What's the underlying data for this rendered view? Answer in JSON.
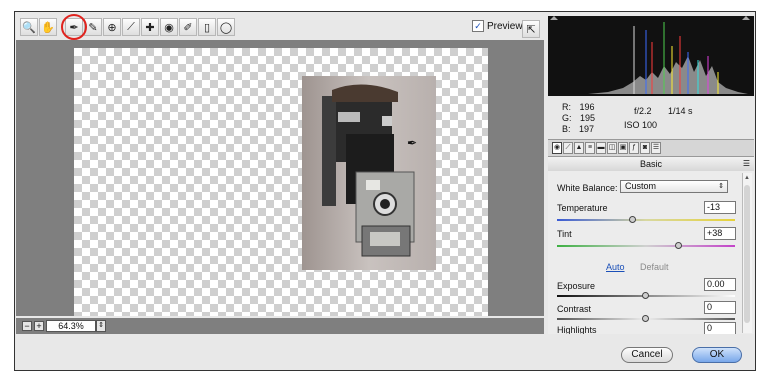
{
  "toolbar": {
    "tools": [
      {
        "icon": "zoom-icon",
        "glyph": "🔍"
      },
      {
        "icon": "hand-icon",
        "glyph": "✋"
      },
      {
        "icon": "white-balance-eyedropper-icon",
        "glyph": "✒"
      },
      {
        "icon": "color-sampler-icon",
        "glyph": "✎"
      },
      {
        "icon": "targeted-adjustment-icon",
        "glyph": "⊕"
      },
      {
        "icon": "straighten-icon",
        "glyph": "⟋"
      },
      {
        "icon": "spot-removal-icon",
        "glyph": "✚"
      },
      {
        "icon": "red-eye-icon",
        "glyph": "◉"
      },
      {
        "icon": "adjustment-brush-icon",
        "glyph": "✐"
      },
      {
        "icon": "graduated-filter-icon",
        "glyph": "▯"
      },
      {
        "icon": "radial-filter-icon",
        "glyph": "◯"
      }
    ],
    "preview_label": "Preview",
    "preview_checked": "✓"
  },
  "zoom": {
    "minus": "−",
    "plus": "+",
    "value": "64.3%",
    "arrow": "⇕"
  },
  "info": {
    "r_label": "R:",
    "r_value": "196",
    "g_label": "G:",
    "g_value": "195",
    "b_label": "B:",
    "b_value": "197",
    "aperture": "f/2.2",
    "shutter": "1/14 s",
    "iso": "ISO 100"
  },
  "panel": {
    "title": "Basic",
    "white_balance_label": "White Balance:",
    "white_balance_value": "Custom",
    "temperature_label": "Temperature",
    "temperature_value": "-13",
    "tint_label": "Tint",
    "tint_value": "+38",
    "auto_label": "Auto",
    "default_label": "Default",
    "exposure_label": "Exposure",
    "exposure_value": "0.00",
    "contrast_label": "Contrast",
    "contrast_value": "0",
    "highlights_label": "Highlights",
    "highlights_value": "0"
  },
  "buttons": {
    "cancel": "Cancel",
    "ok": "OK"
  },
  "colors": {
    "accent": "#1a4fb8",
    "highlight_circle": "#e0231e"
  }
}
